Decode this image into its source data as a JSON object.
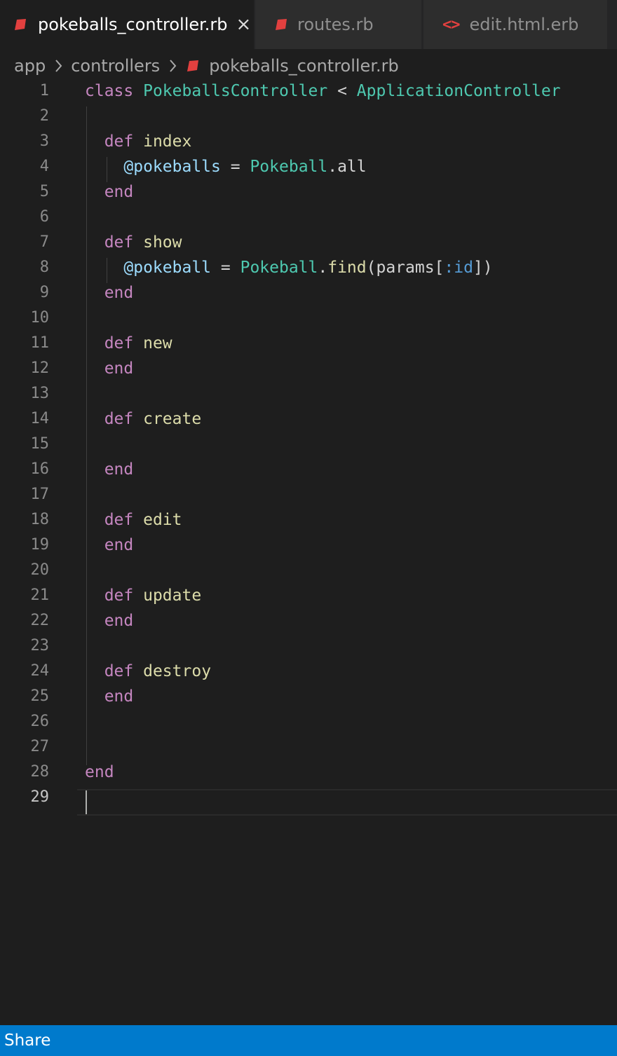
{
  "tabs": [
    {
      "label": "pokeballs_controller.rb",
      "icon": "ruby-icon",
      "active": true
    },
    {
      "label": "routes.rb",
      "icon": "ruby-icon",
      "active": false
    },
    {
      "label": "edit.html.erb",
      "icon": "html-code-icon",
      "active": false
    }
  ],
  "tab_close_glyph": "×",
  "html_icon_glyph": "<>",
  "breadcrumb": {
    "items": [
      "app",
      "controllers",
      "pokeballs_controller.rb"
    ]
  },
  "editor": {
    "line_numbers": [
      "1",
      "2",
      "3",
      "4",
      "5",
      "6",
      "7",
      "8",
      "9",
      "10",
      "11",
      "12",
      "13",
      "14",
      "15",
      "16",
      "17",
      "18",
      "19",
      "20",
      "21",
      "22",
      "23",
      "24",
      "25",
      "26",
      "27",
      "28",
      "29"
    ],
    "code": {
      "l1": {
        "kw": "class",
        "name": "PokeballsController",
        "op": "<",
        "parent": "ApplicationController"
      },
      "l3": {
        "kw": "def",
        "fn": "index"
      },
      "l4": {
        "ivar": "@pokeballs",
        "op": "=",
        "cls": "Pokeball",
        "rest": ".all"
      },
      "l5": {
        "kw": "end"
      },
      "l7": {
        "kw": "def",
        "fn": "show"
      },
      "l8": {
        "ivar": "@pokeball",
        "op": "=",
        "cls": "Pokeball",
        "dot": ".",
        "fn": "find",
        "open": "(params[",
        "sym": ":id",
        "close": "])"
      },
      "l9": {
        "kw": "end"
      },
      "l11": {
        "kw": "def",
        "fn": "new"
      },
      "l12": {
        "kw": "end"
      },
      "l14": {
        "kw": "def",
        "fn": "create"
      },
      "l16": {
        "kw": "end"
      },
      "l18": {
        "kw": "def",
        "fn": "edit"
      },
      "l19": {
        "kw": "end"
      },
      "l21": {
        "kw": "def",
        "fn": "update"
      },
      "l22": {
        "kw": "end"
      },
      "l24": {
        "kw": "def",
        "fn": "destroy"
      },
      "l25": {
        "kw": "end"
      },
      "l28": {
        "kw": "end"
      }
    }
  },
  "statusbar": {
    "share_label": "Share"
  },
  "colors": {
    "keyword": "#c586c0",
    "class_name": "#4ec9b0",
    "function": "#dcdcaa",
    "instance_var": "#9cdcfe",
    "symbol": "#569cd6",
    "ruby_icon": "#e2403f",
    "statusbar": "#007acc"
  }
}
